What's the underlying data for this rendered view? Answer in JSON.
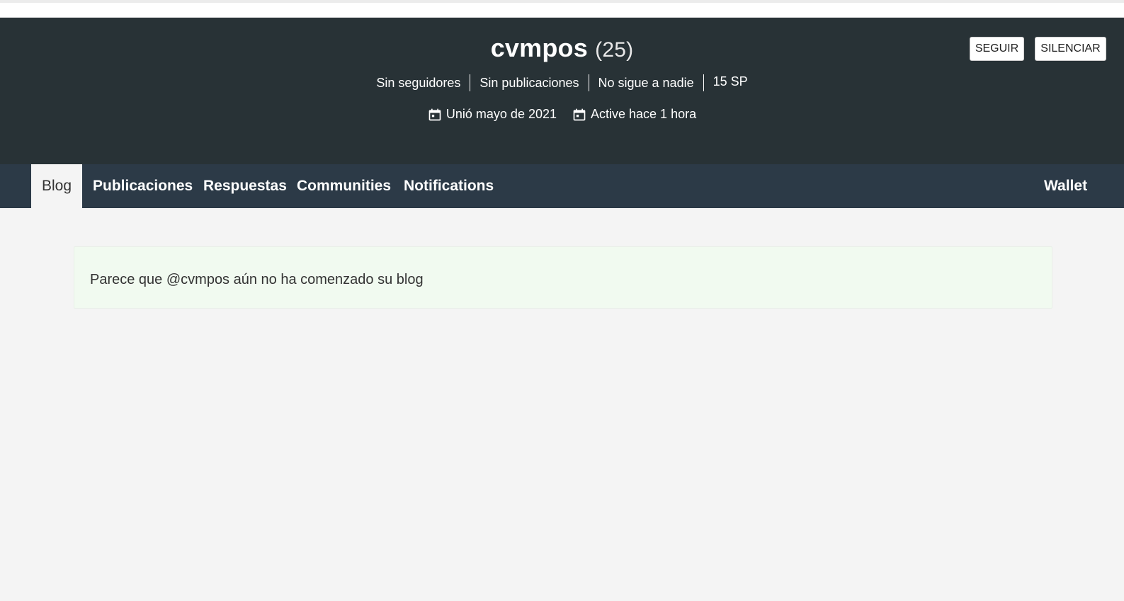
{
  "profile": {
    "username": "cvmpos",
    "reputation": "(25)",
    "stats": [
      "Sin seguidores",
      "Sin publicaciones",
      "No sigue a nadie",
      "15 SP"
    ],
    "joined": "Unió mayo de 2021",
    "active": "Active hace 1 hora"
  },
  "actions": {
    "follow_label": "SEGUIR",
    "mute_label": "SILENCIAR"
  },
  "nav": {
    "tabs": [
      "Blog",
      "Publicaciones",
      "Respuestas",
      "Communities",
      "Notifications"
    ],
    "wallet": "Wallet"
  },
  "content": {
    "empty_message": "Parece que @cvmpos aún no ha comenzado su blog"
  },
  "icons": {
    "calendar": "calendar-icon"
  },
  "colors": {
    "header_bg": "#283236",
    "nav_bg": "#2c3a47",
    "page_bg": "#f4f4f4",
    "notice_bg": "#f1faf0"
  }
}
